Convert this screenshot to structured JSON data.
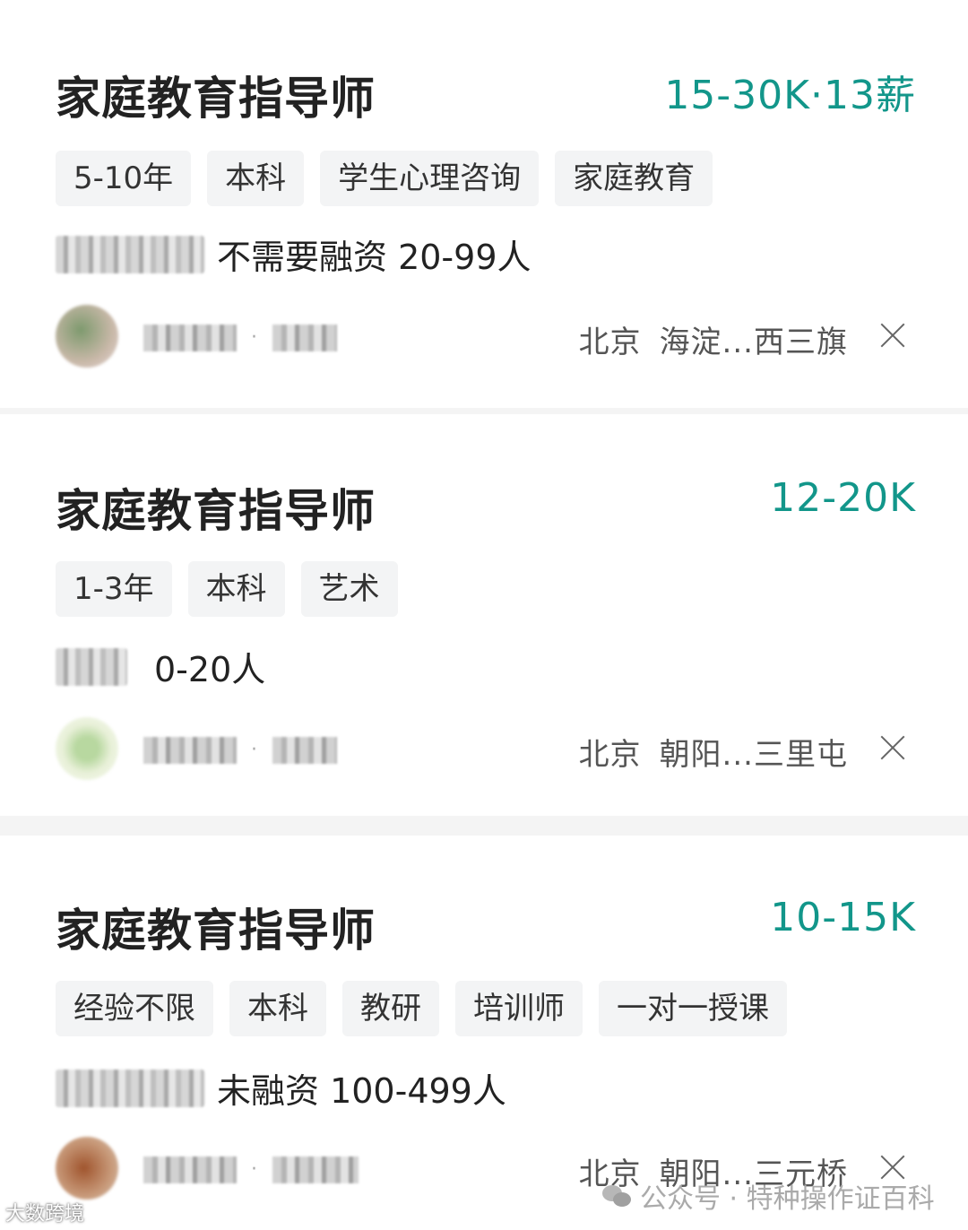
{
  "jobs": [
    {
      "title": "家庭教育指导师",
      "salary": "15-30K·13薪",
      "tags": [
        "5-10年",
        "本科",
        "学生心理咨询",
        "家庭教育"
      ],
      "company_info": "不需要融资 20-99人",
      "location": {
        "city": "北京",
        "district": "海淀...西三旗"
      }
    },
    {
      "title": "家庭教育指导师",
      "salary": "12-20K",
      "tags": [
        "1-3年",
        "本科",
        "艺术"
      ],
      "company_info": "0-20人",
      "location": {
        "city": "北京",
        "district": "朝阳...三里屯"
      }
    },
    {
      "title": "家庭教育指导师",
      "salary": "10-15K",
      "tags": [
        "经验不限",
        "本科",
        "教研",
        "培训师",
        "一对一授课"
      ],
      "company_info": "未融资 100-499人",
      "location": {
        "city": "北京",
        "district": "朝阳...三元桥"
      }
    }
  ],
  "watermarks": {
    "left": "大数跨境",
    "right": "公众号 · 特种操作证百科"
  },
  "colors": {
    "salary": "#12968a",
    "tag_bg": "#f3f4f5"
  },
  "icons": {
    "close": "close-icon",
    "wechat": "wechat-icon"
  }
}
